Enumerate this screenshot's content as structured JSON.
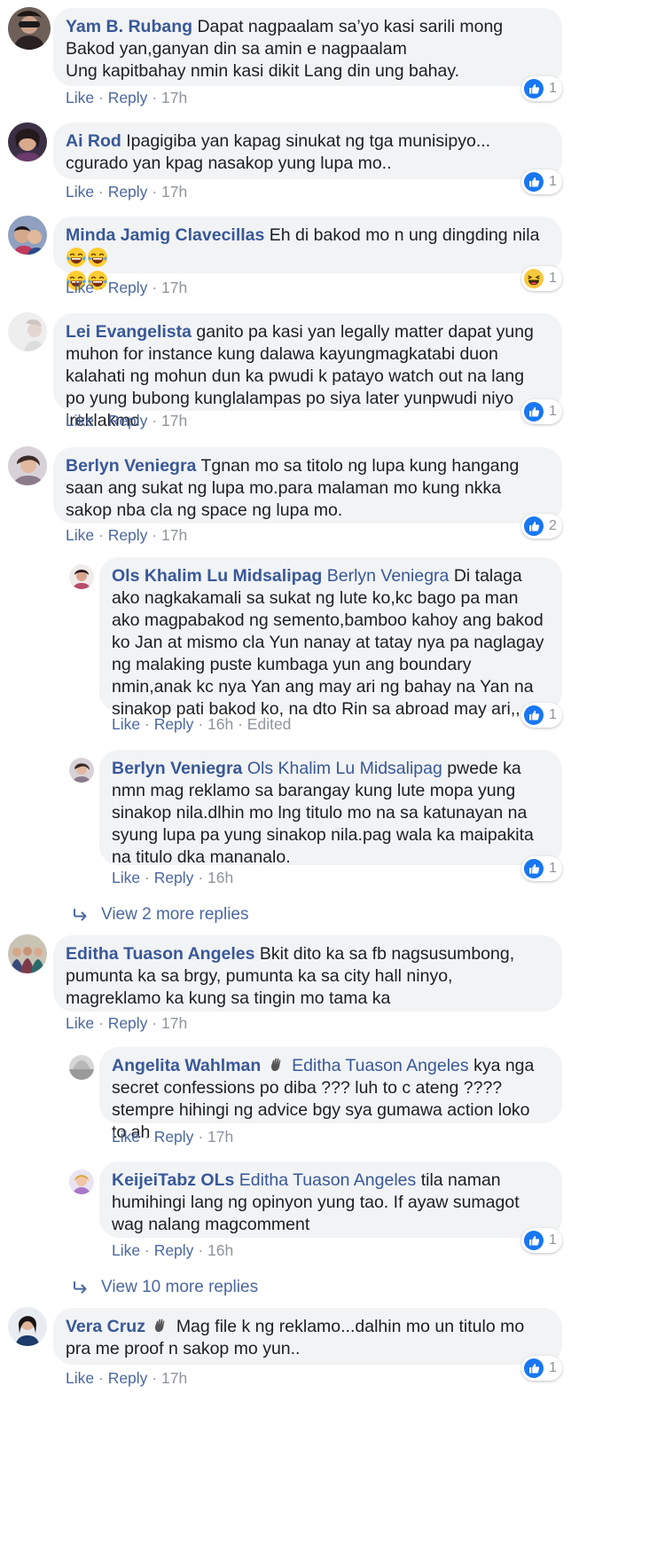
{
  "colors": {
    "link": "#385898",
    "bubble": "#f2f3f5",
    "like_blue": "#1877f2",
    "muted": "#90949c"
  },
  "labels": {
    "like": "Like",
    "reply": "Reply"
  },
  "comments": [
    {
      "author": "Yam B. Rubang",
      "text": "Dapat nagpaalam sa’yo kasi sarili mong Bakod yan,ganyan din sa amin e nagpaalam",
      "text2": "Ung kapitbahay nmin kasi dikit Lang din ung bahay.",
      "time": "17h",
      "reaction": {
        "icon": "like-icon",
        "count": "1"
      }
    },
    {
      "author": "Ai Rod",
      "text": "Ipagigiba yan kapag sinukat ng tga munisipyo... cgurado yan kpag nasakop yung lupa mo..",
      "time": "17h",
      "reaction": {
        "icon": "like-icon",
        "count": "1"
      }
    },
    {
      "author": "Minda Jamig Clavecillas",
      "text": "Eh di bakod mo n ung dingding nila",
      "emoji": "laughing-emoji",
      "time": "17h",
      "reaction": {
        "icon": "haha-icon",
        "count": "1"
      }
    },
    {
      "author": "Lei Evangelista",
      "text": "ganito pa kasi yan legally matter dapat yung muhon for instance kung dalawa kayungmagkatabi duon kalahati ng mohun dun ka pwudi k patayo watch out na lang po yung bubong kunglalampas po siya later yunpwudi niyo ireklakmo",
      "time": "17h",
      "reaction": {
        "icon": "like-icon",
        "count": "1"
      }
    },
    {
      "author": "Berlyn Veniegra",
      "text": "Tgnan mo sa titolo ng lupa kung hangang saan ang sukat ng lupa mo.para malaman mo kung nkka sakop nba cla ng space ng lupa mo.",
      "time": "17h",
      "reaction": {
        "icon": "like-icon",
        "count": "2"
      }
    },
    {
      "author": "Ols Khalim Lu Midsalipag",
      "tag": "Berlyn Veniegra",
      "text": "Di talaga ako nagkakamali sa sukat ng lute ko,kc bago pa man ako magpabakod ng semento,bamboo kahoy ang bakod ko Jan at mismo cla Yun nanay at tatay nya pa naglagay ng malaking puste kumbaga yun ang boundary nmin,anak kc nya Yan ang may ari ng bahay na Yan na sinakop pati bakod ko, na dto Rin sa abroad may ari,,,",
      "time": "16h",
      "edited": "Edited",
      "reaction": {
        "icon": "like-icon",
        "count": "1"
      }
    },
    {
      "author": "Berlyn Veniegra",
      "tag": "Ols Khalim Lu Midsalipag",
      "text": "pwede ka nmn mag reklamo sa barangay kung lute mopa yung sinakop nila.dlhin mo lng titulo mo na sa katunayan na syung lupa pa yung sinakop nila.pag wala ka maipakita na titulo dka mananalo.",
      "time": "16h",
      "reaction": {
        "icon": "like-icon",
        "count": "1"
      }
    },
    {
      "author": "Editha Tuason Angeles",
      "text": "Bkit dito ka sa fb nagsusumbong, pumunta ka sa brgy, pumunta ka sa city hall ninyo, magreklamo ka kung sa tingin mo tama ka",
      "time": "17h"
    },
    {
      "author": "Angelita Wahlman",
      "tag": "Editha Tuason Angeles",
      "text": "kya nga secret confessions po diba ??? luh to c ateng ???? stempre hihingi ng advice bgy sya gumawa action loko to ah",
      "time": "17h"
    },
    {
      "author": "KeijeiTabz OLs",
      "tag": "Editha Tuason Angeles",
      "text": "tila naman humihingi lang ng opinyon yung tao. If ayaw sumagot wag nalang magcomment",
      "time": "16h",
      "reaction": {
        "icon": "like-icon",
        "count": "1"
      }
    },
    {
      "author": "Vera Cruz",
      "text": "Mag file k ng reklamo...dalhin mo un titulo mo pra me proof n sakop mo yun..",
      "time": "17h",
      "reaction": {
        "icon": "like-icon",
        "count": "1"
      }
    }
  ],
  "more_replies": [
    {
      "label": "View 2 more replies"
    },
    {
      "label": "View 10 more replies"
    }
  ]
}
